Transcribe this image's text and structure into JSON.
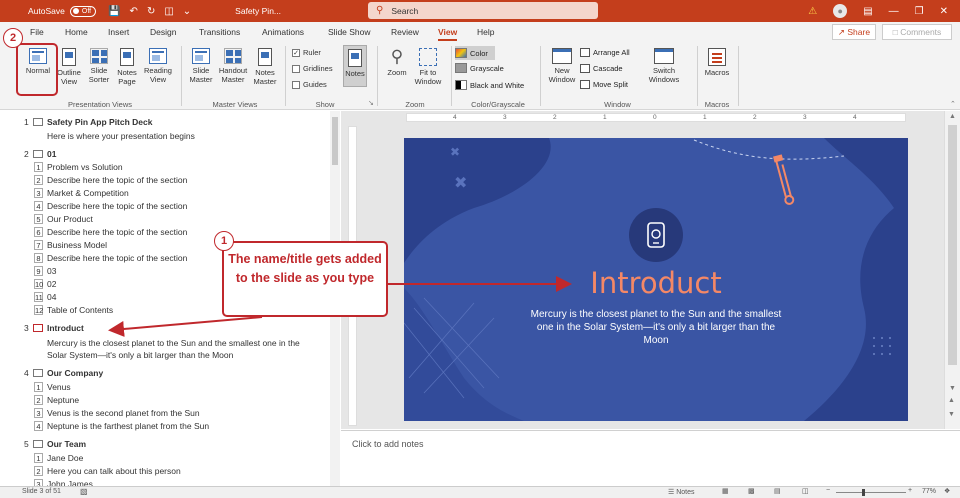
{
  "titlebar": {
    "autosave_label": "AutoSave",
    "autosave_state": "Off",
    "doc_title": "Safety Pin...",
    "search_placeholder": "Search"
  },
  "tabs": [
    "File",
    "Home",
    "Insert",
    "Design",
    "Transitions",
    "Animations",
    "Slide Show",
    "Review",
    "View",
    "Help"
  ],
  "active_tab": "View",
  "share_label": "Share",
  "comments_label": "Comments",
  "ribbon": {
    "presentation_views": {
      "label": "Presentation Views",
      "normal": "Normal",
      "outline": "Outline View",
      "sorter": "Slide Sorter",
      "notes_page": "Notes Page",
      "reading": "Reading View"
    },
    "master_views": {
      "label": "Master Views",
      "slide": "Slide Master",
      "handout": "Handout Master",
      "notes": "Notes Master"
    },
    "show": {
      "label": "Show",
      "ruler": "Ruler",
      "gridlines": "Gridlines",
      "guides": "Guides",
      "notes": "Notes"
    },
    "zoom": {
      "label": "Zoom",
      "zoom": "Zoom",
      "fit": "Fit to Window"
    },
    "color_grayscale": {
      "label": "Color/Grayscale",
      "color": "Color",
      "grayscale": "Grayscale",
      "bw": "Black and White"
    },
    "window": {
      "label": "Window",
      "new": "New Window",
      "arrange": "Arrange All",
      "cascade": "Cascade",
      "move_split": "Move Split",
      "switch": "Switch Windows"
    },
    "macros": {
      "label": "Macros",
      "macros": "Macros"
    }
  },
  "outline": {
    "s1": {
      "num": "1",
      "title": "Safety Pin App Pitch Deck",
      "sub": "Here is where your presentation begins"
    },
    "s2": {
      "num": "2",
      "title": "01",
      "bullets": [
        {
          "n": "1",
          "t": "Problem vs Solution"
        },
        {
          "n": "2",
          "t": "Describe here the topic of the section"
        },
        {
          "n": "3",
          "t": "Market & Competition"
        },
        {
          "n": "4",
          "t": "Describe here the topic of the section"
        },
        {
          "n": "5",
          "t": "Our Product"
        },
        {
          "n": "6",
          "t": "Describe here the topic of the section"
        },
        {
          "n": "7",
          "t": "Business Model"
        },
        {
          "n": "8",
          "t": "Describe here the topic of the section"
        },
        {
          "n": "9",
          "t": "03"
        },
        {
          "n": "10",
          "t": "02"
        },
        {
          "n": "11",
          "t": "04"
        },
        {
          "n": "12",
          "t": "Table of Contents"
        }
      ]
    },
    "s3": {
      "num": "3",
      "title": "Introduct",
      "sub1": "Mercury is the closest planet to the Sun and the smallest one in the",
      "sub2": "Solar System—it's only a bit larger than the Moon"
    },
    "s4": {
      "num": "4",
      "title": "Our Company",
      "bullets": [
        {
          "n": "1",
          "t": "Venus"
        },
        {
          "n": "2",
          "t": "Neptune"
        },
        {
          "n": "3",
          "t": "Venus is the second planet from the Sun"
        },
        {
          "n": "4",
          "t": "Neptune is the farthest planet from the Sun"
        }
      ]
    },
    "s5": {
      "num": "5",
      "title": "Our Team",
      "bullets": [
        {
          "n": "1",
          "t": "Jane Doe"
        },
        {
          "n": "2",
          "t": "Here you can talk about this person"
        },
        {
          "n": "3",
          "t": "John James"
        }
      ]
    }
  },
  "slide": {
    "title": "Introduct",
    "body": "Mercury is the closest planet to the Sun and the smallest one in the Solar System—it's only a bit larger than the Moon",
    "bg_color": "#3a55a4",
    "title_color": "#f48866"
  },
  "ruler_numbers": [
    "4",
    "3",
    "2",
    "1",
    "0",
    "1",
    "2",
    "3",
    "4"
  ],
  "notes_placeholder": "Click to add notes",
  "status": {
    "slide_of": "Slide 3 of 51",
    "notes": "Notes",
    "zoom": "77%"
  },
  "callouts": {
    "c1_num": "1",
    "c1_text": "The name/title gets added to the slide as you type",
    "c2_num": "2"
  }
}
